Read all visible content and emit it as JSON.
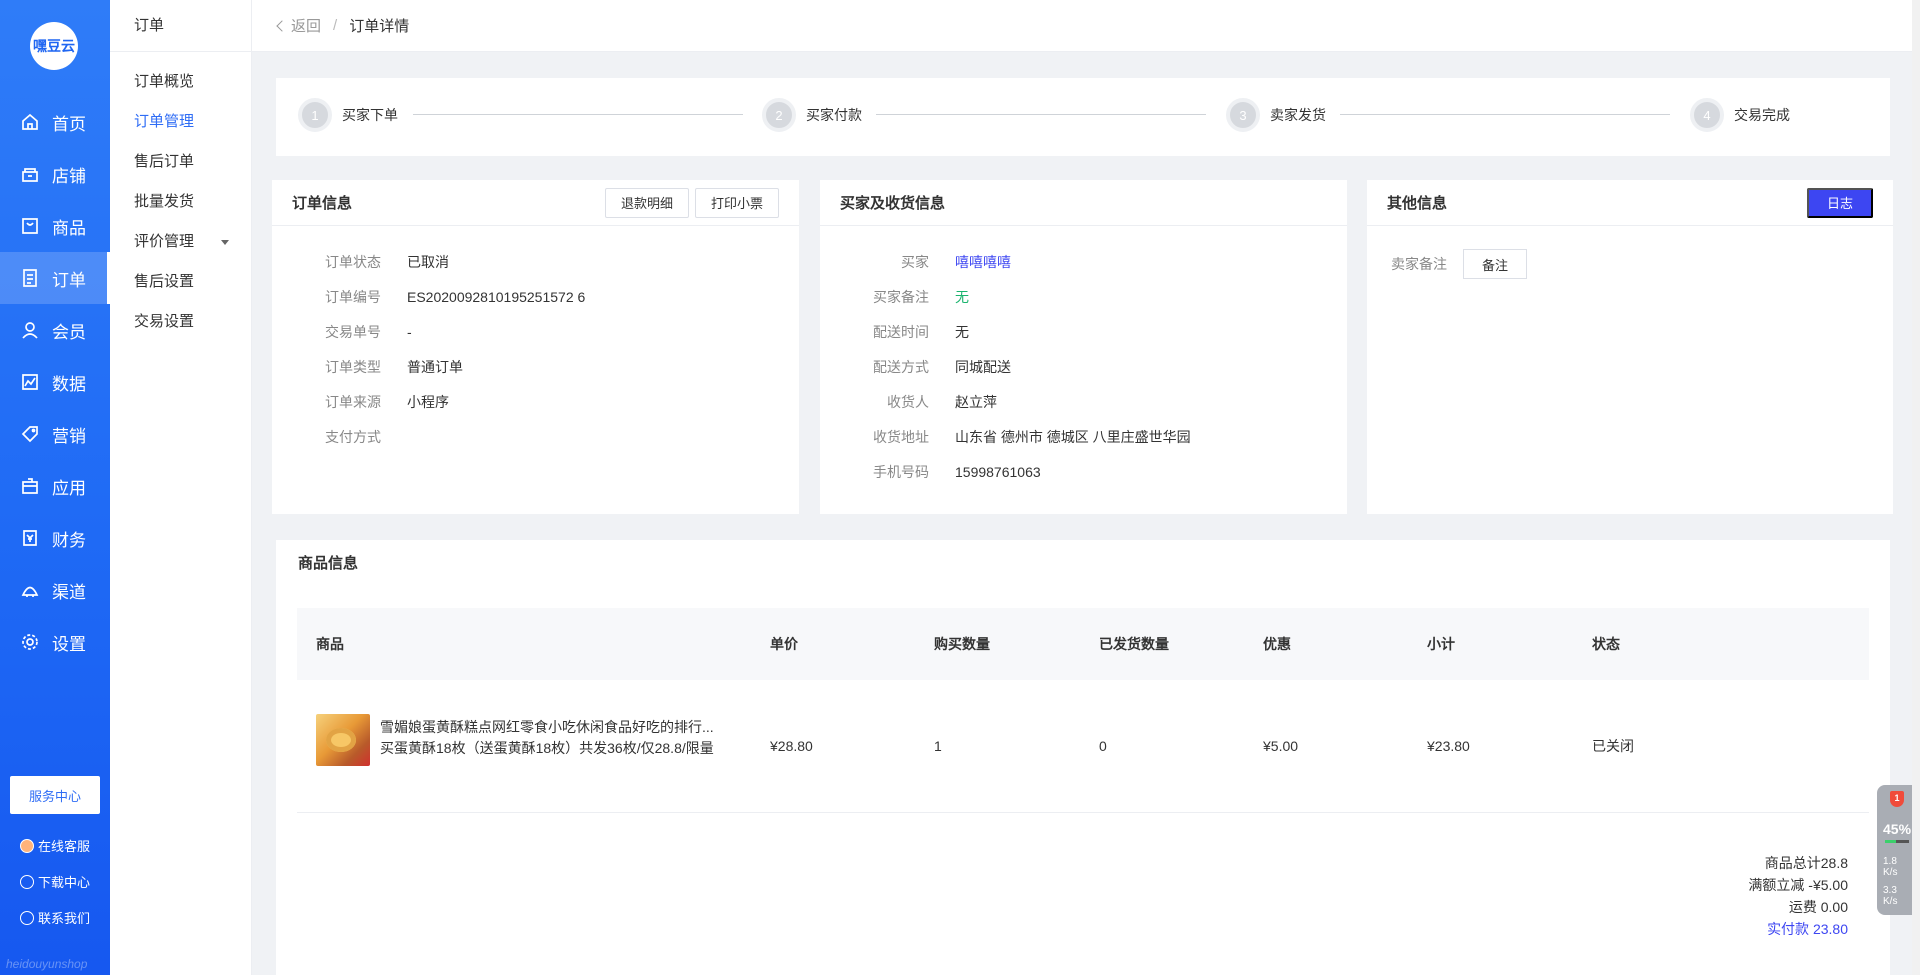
{
  "brand": {
    "logo_text": "嘿豆云",
    "watermark": "heidouyunshop"
  },
  "nav": {
    "items": [
      {
        "label": "首页",
        "icon": "home-icon"
      },
      {
        "label": "店铺",
        "icon": "store-icon"
      },
      {
        "label": "商品",
        "icon": "goods-icon"
      },
      {
        "label": "订单",
        "icon": "order-icon",
        "active": true
      },
      {
        "label": "会员",
        "icon": "member-icon"
      },
      {
        "label": "数据",
        "icon": "chart-icon"
      },
      {
        "label": "营销",
        "icon": "tag-icon"
      },
      {
        "label": "应用",
        "icon": "app-icon"
      },
      {
        "label": "财务",
        "icon": "finance-icon"
      },
      {
        "label": "渠道",
        "icon": "channel-icon"
      },
      {
        "label": "设置",
        "icon": "gear-icon"
      }
    ],
    "service_center": "服务中心",
    "online_service": "在线客服",
    "download_center": "下载中心",
    "contact_us": "联系我们"
  },
  "subnav": {
    "title": "订单",
    "items": [
      "订单概览",
      "订单管理",
      "售后订单",
      "批量发货",
      "评价管理",
      "售后设置",
      "交易设置"
    ]
  },
  "header": {
    "back": "返回",
    "separator": "/",
    "current": "订单详情"
  },
  "steps": [
    {
      "num": "1",
      "label": "买家下单"
    },
    {
      "num": "2",
      "label": "买家付款"
    },
    {
      "num": "3",
      "label": "卖家发货"
    },
    {
      "num": "4",
      "label": "交易完成"
    }
  ],
  "order_info": {
    "title": "订单信息",
    "refund_detail_btn": "退款明细",
    "print_receipt_btn": "打印小票",
    "rows": [
      {
        "key": "订单状态",
        "value": "已取消"
      },
      {
        "key": "订单编号",
        "value": "ES2020092810195251572 6"
      },
      {
        "key": "交易单号",
        "value": "-"
      },
      {
        "key": "订单类型",
        "value": "普通订单"
      },
      {
        "key": "订单来源",
        "value": "小程序"
      },
      {
        "key": "支付方式",
        "value": ""
      }
    ]
  },
  "buyer_info": {
    "title": "买家及收货信息",
    "rows": [
      {
        "key": "买家",
        "value": "嘻嘻嘻嘻"
      },
      {
        "key": "买家备注",
        "value": "无"
      },
      {
        "key": "配送时间",
        "value": "无"
      },
      {
        "key": "配送方式",
        "value": "同城配送"
      },
      {
        "key": "收货人",
        "value": "赵立萍"
      },
      {
        "key": "收货地址",
        "value": "山东省 德州市 德城区 八里庄盛世华园"
      },
      {
        "key": "手机号码",
        "value": "15998761063"
      }
    ]
  },
  "other_info": {
    "title": "其他信息",
    "log_btn": "日志",
    "seller_remark_label": "卖家备注",
    "remark_btn": "备注"
  },
  "goods": {
    "title": "商品信息",
    "columns": [
      "商品",
      "单价",
      "购买数量",
      "已发货数量",
      "优惠",
      "小计",
      "状态"
    ],
    "rows": [
      {
        "name": "雪媚娘蛋黄酥糕点网红零食小吃休闲食品好吃的排行...",
        "spec": "买蛋黄酥18枚（送蛋黄酥18枚）共发36枚/仅28.8/限量",
        "price": "¥28.80",
        "qty": "1",
        "shipped": "0",
        "discount": "¥5.00",
        "subtotal": "¥23.80",
        "status": "已关闭"
      }
    ],
    "summary": {
      "total": "商品总计28.8",
      "reduction": "满额立减 -¥5.00",
      "freight": "运费 0.00",
      "paid": "实付款 23.80"
    }
  },
  "widget": {
    "badge": "1",
    "cpu": "45%",
    "cpu_fraction": 0.45,
    "up": "1.8",
    "up_unit": "K/s",
    "down": "3.3",
    "down_unit": "K/s"
  },
  "colors": {
    "sidebar": "#1f6af5",
    "accent": "#3d46f2",
    "green": "#1bb46e"
  }
}
